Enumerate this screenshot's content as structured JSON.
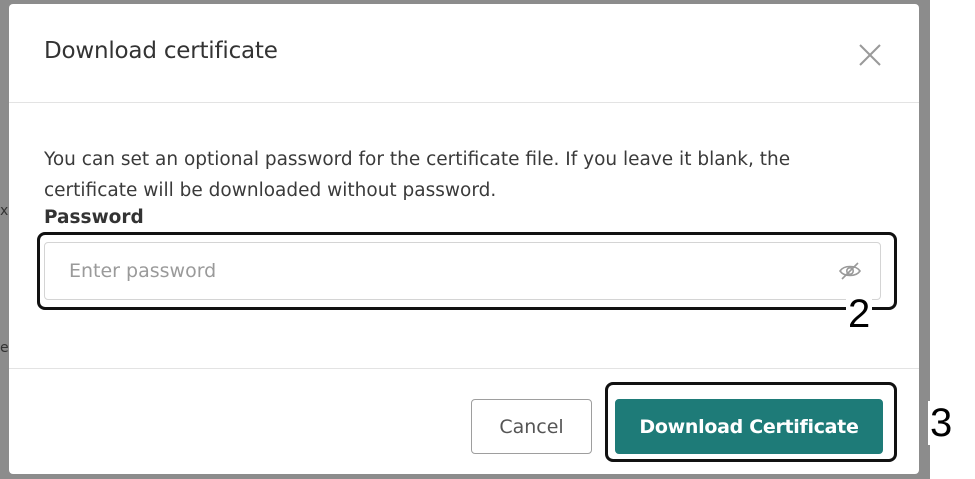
{
  "dialog": {
    "title": "Download certificate",
    "description": "You can set an optional password for the certificate file. If you leave it blank, the certificate will be downloaded without password.",
    "password_label": "Password",
    "password_placeholder": "Enter password",
    "password_value": "",
    "cancel_label": "Cancel",
    "download_label": "Download Certificate"
  },
  "annotations": {
    "password_callout": "2",
    "download_callout": "3"
  },
  "backdrop": {
    "fragment_1": "x",
    "fragment_2": "e"
  },
  "colors": {
    "primary": "#1e7b78",
    "backdrop": "#8c8c8c"
  },
  "icons": {
    "close": "close-icon",
    "toggle_password": "eye-slash-icon"
  }
}
